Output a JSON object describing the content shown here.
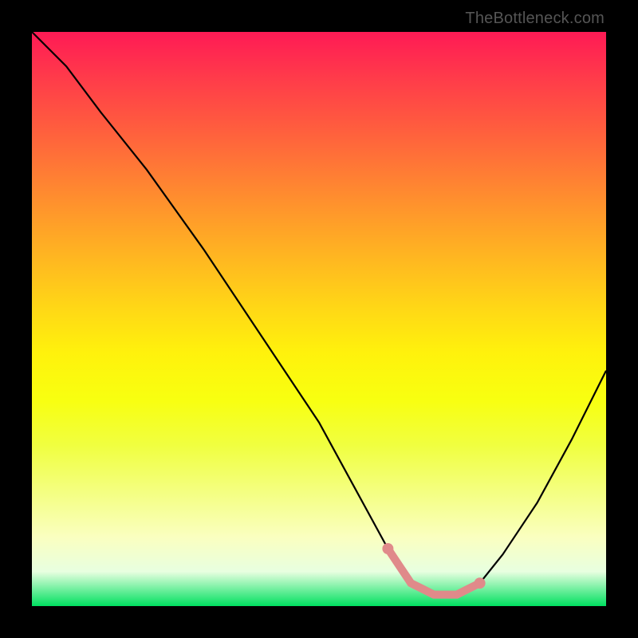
{
  "watermark": "TheBottleneck.com",
  "chart_data": {
    "type": "line",
    "title": "",
    "xlabel": "",
    "ylabel": "",
    "xlim": [
      0,
      100
    ],
    "ylim": [
      0,
      100
    ],
    "series": [
      {
        "name": "bottleneck-curve",
        "x": [
          0,
          6,
          12,
          20,
          30,
          40,
          50,
          56,
          62,
          66,
          70,
          74,
          78,
          82,
          88,
          94,
          100
        ],
        "values": [
          100,
          94,
          86,
          76,
          62,
          47,
          32,
          21,
          10,
          4,
          2,
          2,
          4,
          9,
          18,
          29,
          41
        ]
      }
    ],
    "highlight_band": {
      "x_start": 62,
      "x_end": 78,
      "y": 2
    },
    "gradient_stops": [
      {
        "pos": 0,
        "color": "#ff1a55"
      },
      {
        "pos": 25,
        "color": "#ff8a30"
      },
      {
        "pos": 50,
        "color": "#ffe010"
      },
      {
        "pos": 85,
        "color": "#f5ffb0"
      },
      {
        "pos": 100,
        "color": "#00e060"
      }
    ]
  }
}
